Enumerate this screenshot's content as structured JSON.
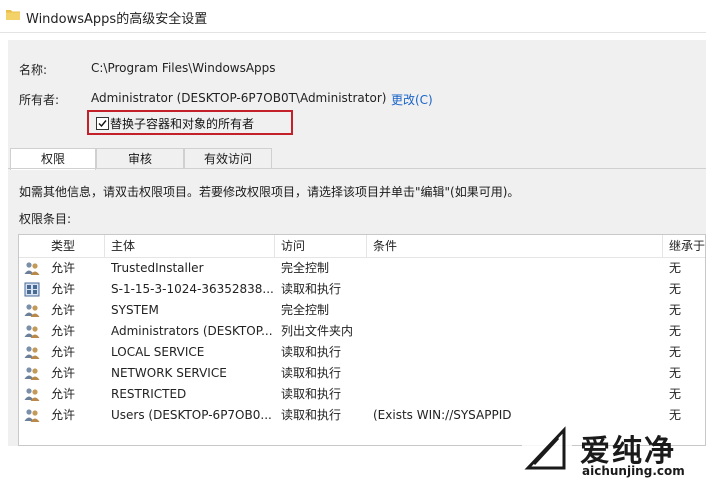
{
  "window": {
    "title": "WindowsApps的高级安全设置"
  },
  "name_row": {
    "label": "名称:",
    "value": "C:\\Program Files\\WindowsApps"
  },
  "owner_row": {
    "label": "所有者:",
    "value": "Administrator (DESKTOP-6P7OB0T\\Administrator)",
    "change_link": "更改(C)"
  },
  "replace_checkbox": {
    "label": "替换子容器和对象的所有者",
    "checked": true
  },
  "tabs": [
    {
      "label": "权限",
      "active": true
    },
    {
      "label": "审核",
      "active": false
    },
    {
      "label": "有效访问",
      "active": false
    }
  ],
  "info_text": "如需其他信息，请双击权限项目。若要修改权限项目，请选择该项目并单击\"编辑\"(如果可用)。",
  "entries_label": "权限条目:",
  "table": {
    "columns": [
      "类型",
      "主体",
      "访问",
      "条件",
      "继承于"
    ],
    "rows": [
      {
        "icon": "users-icon",
        "type": "允许",
        "principal": "TrustedInstaller",
        "access": "完全控制",
        "condition": "",
        "inherited": "无"
      },
      {
        "icon": "app-package-icon",
        "type": "允许",
        "principal": "S-1-15-3-1024-36352838...",
        "access": "读取和执行",
        "condition": "",
        "inherited": "无"
      },
      {
        "icon": "users-icon",
        "type": "允许",
        "principal": "SYSTEM",
        "access": "完全控制",
        "condition": "",
        "inherited": "无"
      },
      {
        "icon": "users-icon",
        "type": "允许",
        "principal": "Administrators (DESKTOP...",
        "access": "列出文件夹内",
        "condition": "",
        "inherited": "无"
      },
      {
        "icon": "users-icon",
        "type": "允许",
        "principal": "LOCAL SERVICE",
        "access": "读取和执行",
        "condition": "",
        "inherited": "无"
      },
      {
        "icon": "users-icon",
        "type": "允许",
        "principal": "NETWORK SERVICE",
        "access": "读取和执行",
        "condition": "",
        "inherited": "无"
      },
      {
        "icon": "users-icon",
        "type": "允许",
        "principal": "RESTRICTED",
        "access": "读取和执行",
        "condition": "",
        "inherited": "无"
      },
      {
        "icon": "users-icon",
        "type": "允许",
        "principal": "Users (DESKTOP-6P7OB0...",
        "access": "读取和执行",
        "condition": "(Exists WIN://SYSAPPID",
        "inherited": "无"
      }
    ]
  },
  "watermark": {
    "brand": "爱纯净",
    "url": "aichunjing.com"
  },
  "colors": {
    "highlight_border": "#c4202a",
    "link": "#1a64c8",
    "panel": "#f0f0f0"
  }
}
